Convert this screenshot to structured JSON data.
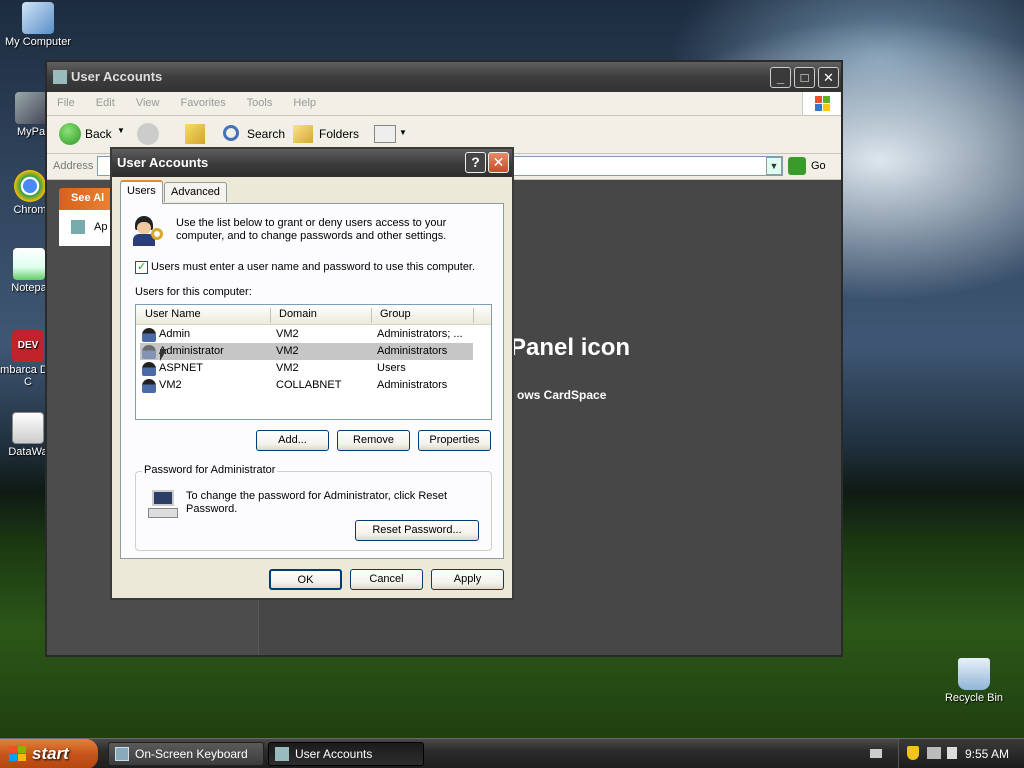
{
  "desktop": {
    "icons": [
      {
        "label": "My Computer"
      },
      {
        "label": "MyPa"
      },
      {
        "label": "Chrom"
      },
      {
        "label": "Notepa"
      },
      {
        "label": "Embarca Dev-C"
      },
      {
        "label": "DataWa"
      },
      {
        "label": "Recycle Bin"
      }
    ]
  },
  "explorer": {
    "title": "User Accounts",
    "menu": [
      "File",
      "Edit",
      "View",
      "Favorites",
      "Tools",
      "Help"
    ],
    "toolbar": {
      "back": "Back",
      "search": "Search",
      "folders": "Folders"
    },
    "address_label": "Address",
    "go_label": "Go",
    "see_also": "See Al",
    "left_item": "Ap",
    "heading_fragment": "Panel icon",
    "sub_fragment": "ows CardSpace"
  },
  "dialog": {
    "title": "User Accounts",
    "help_label": "?",
    "close_label": "✕",
    "tabs": [
      {
        "label": "Users"
      },
      {
        "label": "Advanced"
      }
    ],
    "intro_text": "Use the list below to grant or deny users access to your computer, and to change passwords and other settings.",
    "checkbox_label": "Users must enter a user name and password to use this computer.",
    "checkbox_checked": true,
    "list_label": "Users for this computer:",
    "columns": [
      "User Name",
      "Domain",
      "Group"
    ],
    "rows": [
      {
        "name": "Admin",
        "domain": "VM2",
        "group": "Administrators; ..."
      },
      {
        "name": "Administrator",
        "domain": "VM2",
        "group": "Administrators",
        "selected": true
      },
      {
        "name": "ASPNET",
        "domain": "VM2",
        "group": "Users"
      },
      {
        "name": "VM2",
        "domain": "COLLABNET",
        "group": "Administrators"
      }
    ],
    "buttons": {
      "add": "Add...",
      "remove": "Remove",
      "properties": "Properties"
    },
    "password_group": {
      "legend": "Password for Administrator",
      "text": "To change the password for Administrator, click Reset Password.",
      "reset": "Reset Password..."
    },
    "footer": {
      "ok": "OK",
      "cancel": "Cancel",
      "apply": "Apply"
    }
  },
  "taskbar": {
    "start": "start",
    "tasks": [
      {
        "label": "On-Screen Keyboard"
      },
      {
        "label": "User Accounts"
      }
    ],
    "clock": "9:55 AM"
  }
}
